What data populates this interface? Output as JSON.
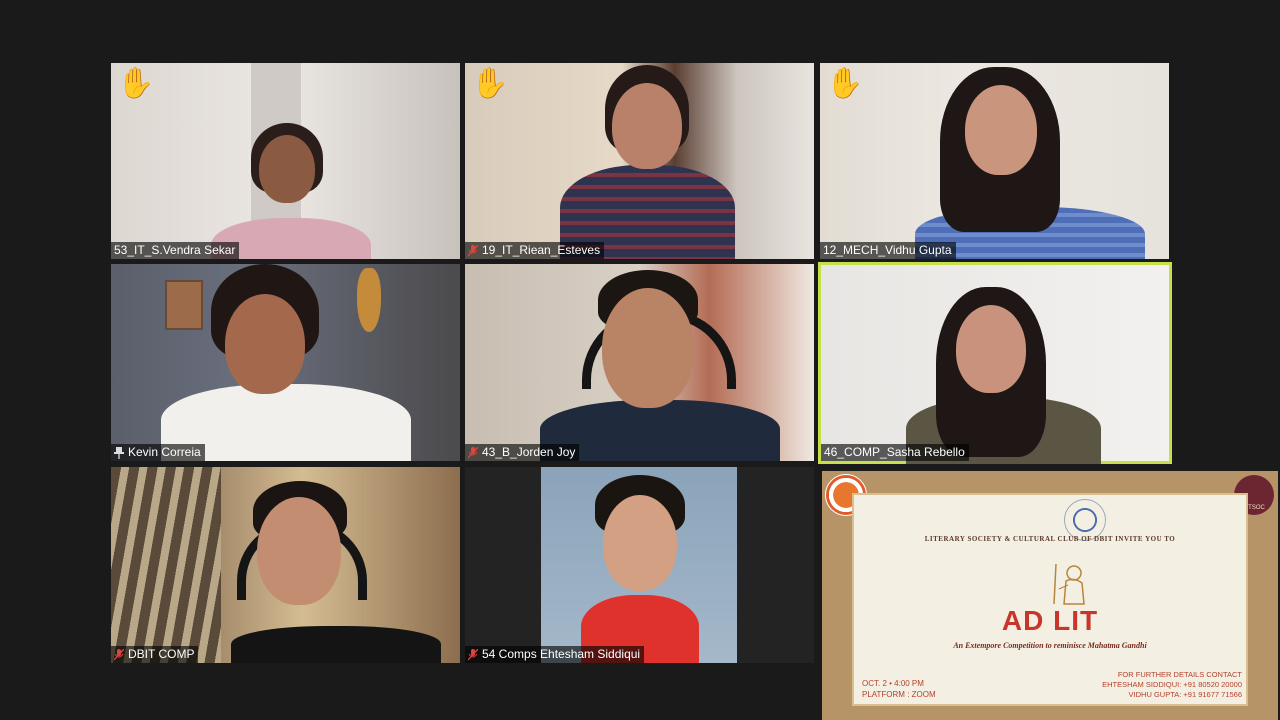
{
  "participants": [
    {
      "name": "53_IT_S.Vendra Sekar",
      "muted": false,
      "hand_raised": true
    },
    {
      "name": "19_IT_Riean_Esteves",
      "muted": true,
      "hand_raised": true
    },
    {
      "name": "12_MECH_Vidhu Gupta",
      "muted": false,
      "hand_raised": true
    },
    {
      "name": "Kevin Correia",
      "muted": false,
      "pinned": true,
      "hand_raised": false
    },
    {
      "name": "43_B_Jorden Joy",
      "muted": true,
      "hand_raised": false
    },
    {
      "name": "46_COMP_Sasha Rebello",
      "muted": false,
      "hand_raised": false,
      "active_speaker": true
    },
    {
      "name": "DBIT COMP",
      "muted": true,
      "hand_raised": false
    },
    {
      "name": "54 Comps Ehtesham Siddiqui",
      "muted": true,
      "hand_raised": false
    }
  ],
  "icons": {
    "hand": "raised-hand-icon",
    "mute": "mic-muted-icon",
    "pin": "pin-icon"
  },
  "colors": {
    "background": "#1a1a1a",
    "active_speaker_border": "#c5e04a",
    "muted_icon": "#e0443e",
    "hand": "#f2b33d"
  },
  "poster": {
    "invite_line": "LITERARY SOCIETY & CULTURAL CLUB OF DBIT INVITE YOU TO",
    "title": "AD LIT",
    "subtitle": "An Extempore Competition to reminisce Mahatma Gandhi",
    "date_line": "OCT. 2 • 4:00 PM",
    "platform_line": "PLATFORM : ZOOM",
    "contact_heading": "FOR FURTHER DETAILS CONTACT",
    "contact_1": "EHTESHAM SIDDIQUI: +91 80520 20000",
    "contact_2": "VIDHU GUPTA: +91 91677 71566",
    "right_logo_text": "LITSOC"
  }
}
